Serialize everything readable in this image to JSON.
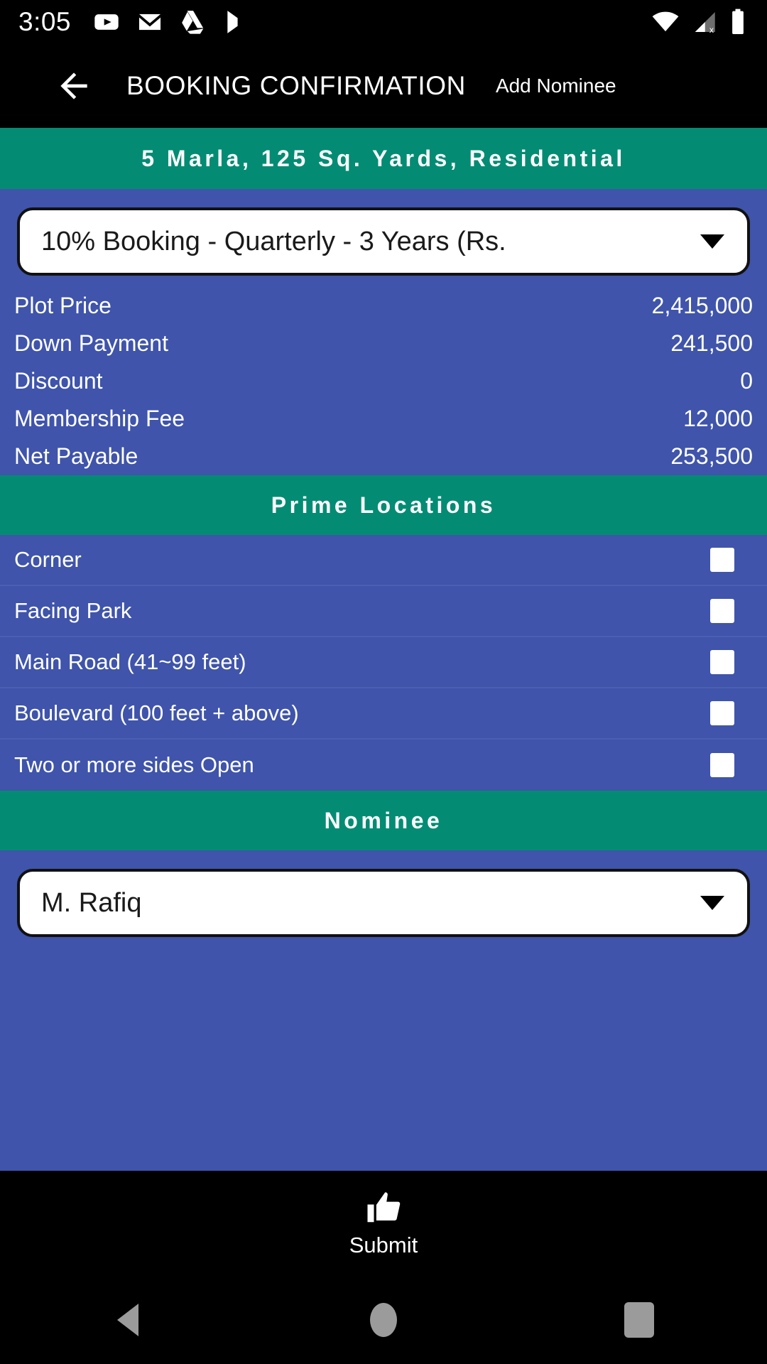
{
  "status_bar": {
    "time": "3:05",
    "left_icons": [
      "youtube-icon",
      "gmail-icon",
      "google-drive-icon",
      "play-store-icon"
    ],
    "right_icons": [
      "wifi-icon",
      "cellular-no-sim-icon",
      "battery-icon"
    ]
  },
  "app_bar": {
    "back_icon": "back-arrow-icon",
    "title": "BOOKING CONFIRMATION",
    "action_label": "Add Nominee"
  },
  "plot_subtitle": "5 Marla, 125 Sq. Yards, Residential",
  "payment_plan": {
    "selected": "10% Booking - Quarterly - 3 Years (Rs.",
    "caret_icon": "chevron-down-icon"
  },
  "price_details": [
    {
      "label": "Plot Price",
      "value": "2,415,000"
    },
    {
      "label": "Down Payment",
      "value": "241,500"
    },
    {
      "label": "Discount",
      "value": "0"
    },
    {
      "label": "Membership Fee",
      "value": "12,000"
    },
    {
      "label": "Net Payable",
      "value": "253,500"
    }
  ],
  "prime_locations": {
    "header": "Prime Locations",
    "options": [
      {
        "label": "Corner",
        "checked": false
      },
      {
        "label": "Facing Park",
        "checked": false
      },
      {
        "label": "Main Road (41~99 feet)",
        "checked": false
      },
      {
        "label": "Boulevard (100 feet + above)",
        "checked": false
      },
      {
        "label": "Two or more sides Open",
        "checked": false
      }
    ]
  },
  "nominee": {
    "header": "Nominee",
    "selected": "M. Rafiq",
    "caret_icon": "chevron-down-icon"
  },
  "submit": {
    "icon": "thumbs-up-icon",
    "label": "Submit"
  },
  "nav_bar": {
    "back": "nav-back-icon",
    "home": "nav-home-icon",
    "recents": "nav-recents-icon"
  },
  "colors": {
    "blue": "#3F54AA",
    "teal": "#038C73",
    "black": "#000000",
    "white": "#FFFFFF"
  }
}
